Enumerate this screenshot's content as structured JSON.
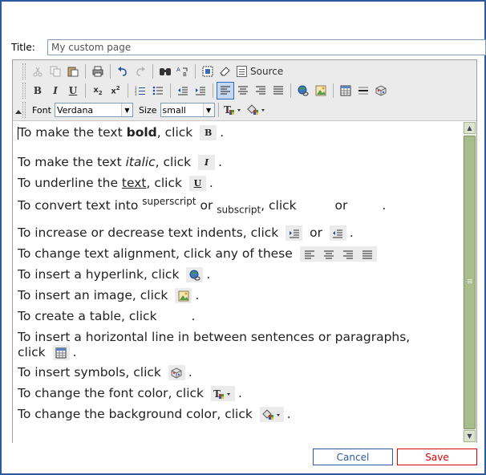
{
  "title_field": {
    "label": "Title:",
    "value": "My custom page"
  },
  "toolbar": {
    "row1": [
      {
        "icon": "cut-icon",
        "disabled": true
      },
      {
        "icon": "copy-icon",
        "disabled": true
      },
      {
        "icon": "paste-icon"
      },
      {
        "icon": "print-icon"
      },
      {
        "icon": "undo-icon"
      },
      {
        "icon": "redo-icon",
        "disabled": true
      },
      {
        "icon": "find-icon"
      },
      {
        "icon": "replace-icon"
      },
      {
        "icon": "select-all-icon"
      },
      {
        "icon": "remove-format-icon"
      }
    ],
    "source_label": "Source",
    "font_label": "Font",
    "font_value": "Verdana",
    "size_label": "Size",
    "size_value": "small"
  },
  "content": {
    "lines": [
      {
        "before": "To make the text ",
        "bold": "bold",
        "after": ", click "
      },
      {
        "before": "To make the text ",
        "italic": "italic",
        "after": ", click "
      },
      {
        "before": "To underline the ",
        "underline": "text",
        "after": ", click "
      },
      {
        "before": "To convert text into ",
        "sup": "superscript",
        "mid": " or ",
        "sub": "subscript",
        "after": ", click ",
        "or": " or "
      },
      {
        "text": "To increase or decrease text indents, click ",
        "or": " or "
      },
      {
        "text": "To change text alignment, click any of these "
      },
      {
        "text": "To insert a hyperlink, click "
      },
      {
        "text": "To insert an image, click "
      },
      {
        "text": "To create a table, click "
      },
      {
        "text": "To insert a horizontal line in between sentences or paragraphs,",
        "text2": "click "
      },
      {
        "text": "To insert symbols, click "
      },
      {
        "text": "To change the font color, click "
      },
      {
        "text": "To change the background color, click "
      }
    ]
  },
  "buttons": {
    "cancel": "Cancel",
    "save": "Save"
  },
  "colors": {
    "frame": "#2c5aa0",
    "save": "#e00000",
    "scroll": "#a9bd8c"
  }
}
